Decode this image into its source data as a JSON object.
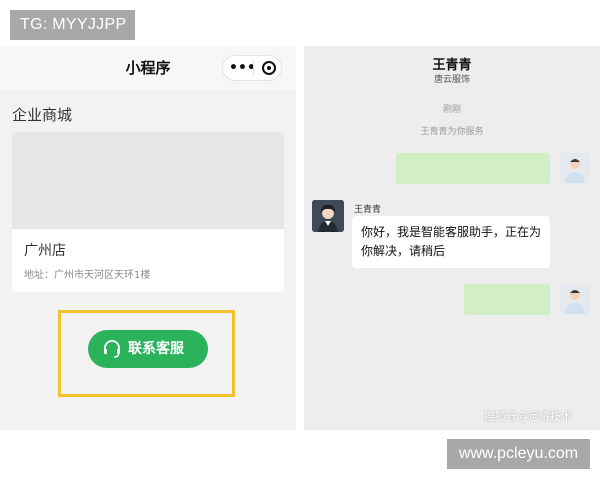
{
  "overlay": {
    "tg_label": "TG: MYYJJPP",
    "site_label": "www.pcleyu.com"
  },
  "mini_program": {
    "title": "小程序",
    "capsule_more": "•••",
    "section_title": "企业商城",
    "store": {
      "name": "广州店",
      "address": "地址：广州市天河区天环1楼"
    },
    "contact_button_label": "联系客服",
    "accent_color": "#2bb35c",
    "highlight_color": "#f2c12e"
  },
  "chat": {
    "contact_name": "王青青",
    "contact_subtitle": "唐云服饰",
    "time_label": "刚刚",
    "system_message": "王青青为你服务",
    "agent_sender_name": "王青青",
    "agent_message": "你好，我是智能客服助手，正在为你解决，请稍后",
    "watermark": "搜狐号@远侍技术"
  }
}
